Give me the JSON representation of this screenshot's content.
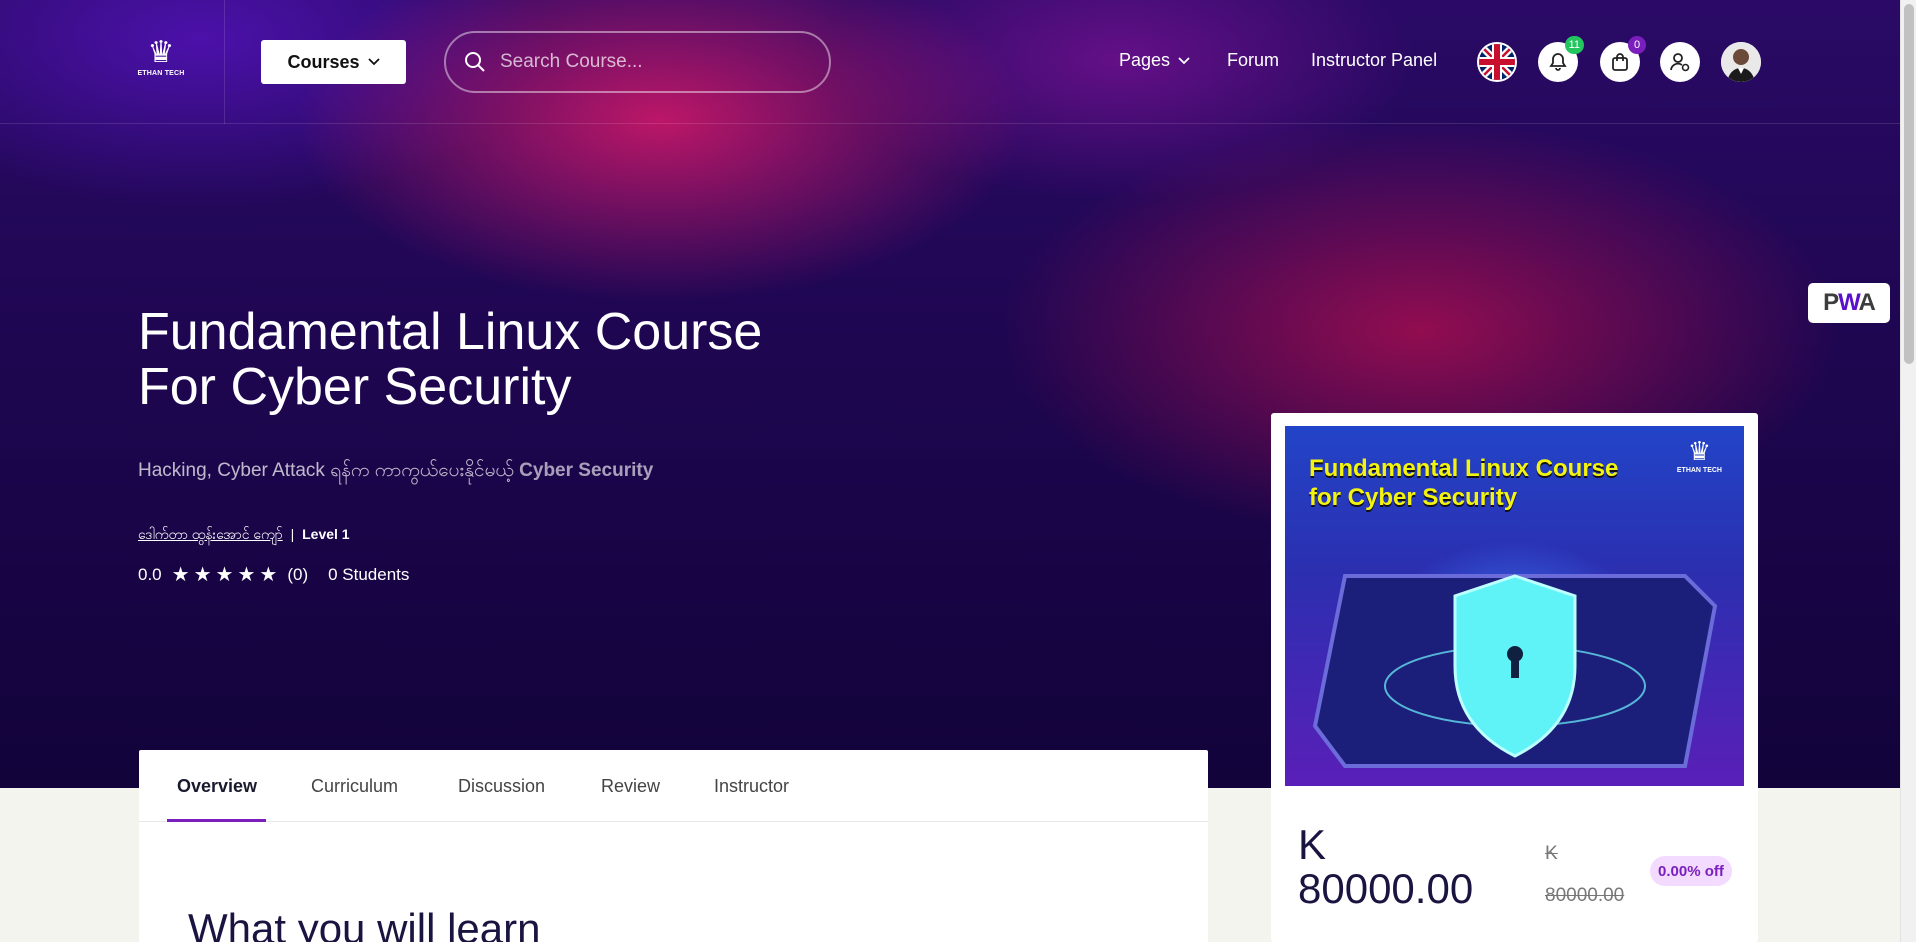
{
  "header": {
    "logo_text": "ETHAN TECH",
    "courses_label": "Courses",
    "search_placeholder": "Search Course...",
    "nav": {
      "pages": "Pages",
      "forum": "Forum",
      "instructor_panel": "Instructor Panel"
    },
    "notifications_count": "11",
    "cart_count": "0"
  },
  "pwa_label": "PWA",
  "course": {
    "title": "Fundamental Linux Course For Cyber Security",
    "subtitle_prefix": "Hacking, Cyber Attack ရန်က ကာကွယ်ပေးနိုင်မယ့်",
    "subtitle_bold": "Cyber Security",
    "instructor": "ဒေါက်တာ ထွန်းအောင် ကျော်",
    "level": "Level 1",
    "rating": "0.0",
    "review_count": "(0)",
    "students": "0 Students",
    "stars": 0
  },
  "tabs": [
    "Overview",
    "Curriculum",
    "Discussion",
    "Review",
    "Instructor"
  ],
  "active_tab": "Overview",
  "section_title": "What you will learn",
  "card": {
    "thumb_title": "Fundamental Linux Course for Cyber Security",
    "thumb_logo": "ETHAN TECH",
    "currency": "K",
    "price": "80000.00",
    "old_currency": "K",
    "old_price": "80000.00",
    "discount": "0.00% off"
  },
  "colors": {
    "accent": "#7a1fbd",
    "notif_badge": "#22c55e",
    "cart_badge": "#7a1fbd"
  }
}
